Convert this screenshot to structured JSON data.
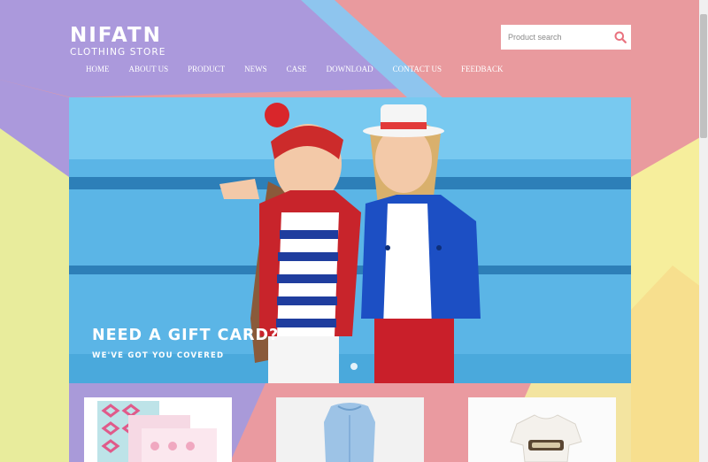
{
  "brand": {
    "name": "NIFATN",
    "tagline": "CLOTHING STORE"
  },
  "search": {
    "placeholder": "Product search",
    "icon": "search-icon"
  },
  "nav": {
    "items": [
      {
        "label": "HOME"
      },
      {
        "label": "ABOUT US"
      },
      {
        "label": "PRODUCT"
      },
      {
        "label": "NEWS"
      },
      {
        "label": "CASE"
      },
      {
        "label": "DOWNLOAD"
      },
      {
        "label": "CONTACT US"
      },
      {
        "label": "FEEDBACK"
      }
    ]
  },
  "banner": {
    "headline": "NEED A GIFT CARD?",
    "subline": "WE'VE GOT YOU COVERED",
    "slide_indicator": "1"
  },
  "products": [
    {
      "name": "patterned-blanket"
    },
    {
      "name": "baby-sleep-sack"
    },
    {
      "name": "baby-bodysuit"
    }
  ],
  "colors": {
    "purple": "#ab99dc",
    "pink": "#ea9aa0",
    "blue": "#8ec5ee",
    "yellow": "#f6ee9c",
    "lime": "#e8ec9c",
    "accent": "#e9727f",
    "sea": "#5bb5e6"
  }
}
